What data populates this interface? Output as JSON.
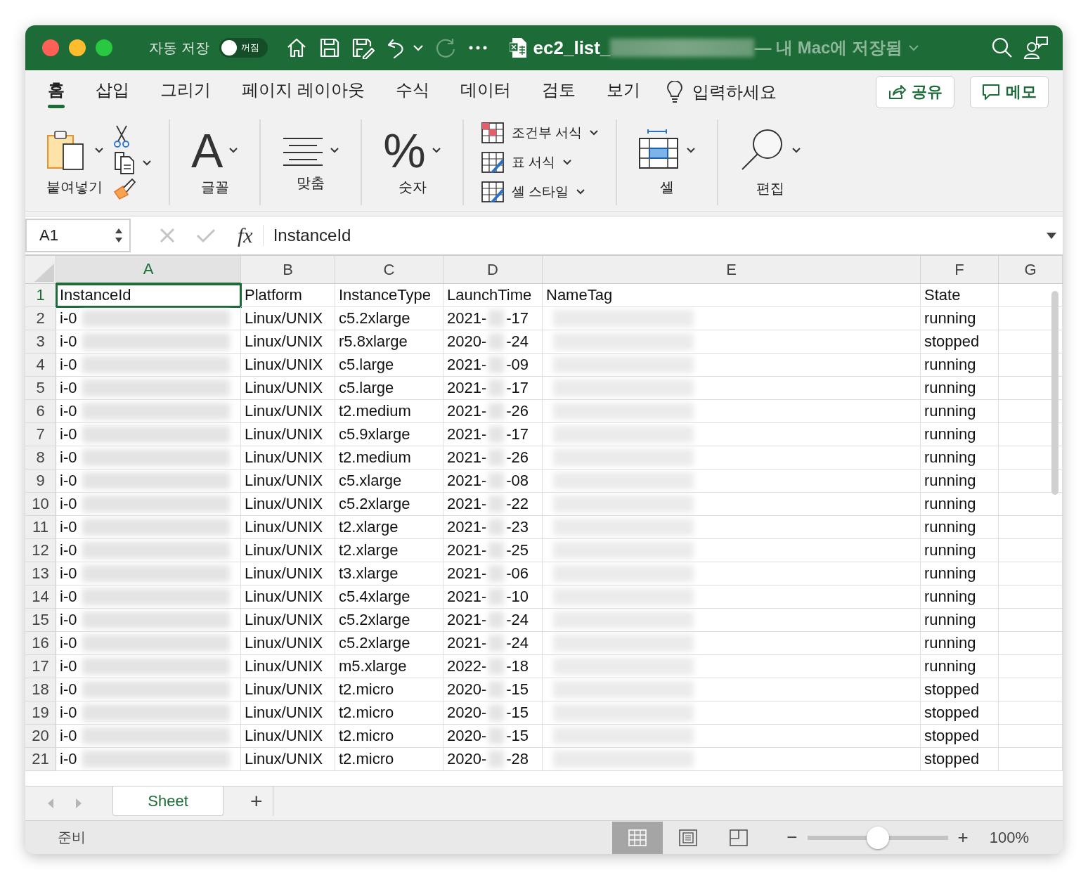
{
  "window": {
    "autosave_label": "자동 저장",
    "autosave_toggle": {
      "label": "꺼짐",
      "on": false
    },
    "file_name": "ec2_list_",
    "save_location": "— 내 Mac에 저장됨"
  },
  "ribbon_tabs": [
    {
      "label": "홈",
      "selected": true
    },
    {
      "label": "삽입",
      "selected": false
    },
    {
      "label": "그리기",
      "selected": false
    },
    {
      "label": "페이지 레이아웃",
      "selected": false
    },
    {
      "label": "수식",
      "selected": false
    },
    {
      "label": "데이터",
      "selected": false
    },
    {
      "label": "검토",
      "selected": false
    },
    {
      "label": "보기",
      "selected": false
    }
  ],
  "tell_me": "입력하세요",
  "share_button": "공유",
  "comments_button": "메모",
  "ribbon_groups": [
    {
      "kind": "paste",
      "label": "붙여넣기"
    },
    {
      "kind": "glyph",
      "glyph": "A",
      "label": "글꼴"
    },
    {
      "kind": "align",
      "label": "맞춤"
    },
    {
      "kind": "glyph",
      "glyph": "%",
      "label": "숫자"
    },
    {
      "kind": "styles",
      "items": [
        "조건부 서식",
        "표 서식",
        "셀 스타일"
      ]
    },
    {
      "kind": "cells",
      "label": "셀"
    },
    {
      "kind": "find",
      "label": "편집"
    }
  ],
  "formula_bar": {
    "name_box": "A1",
    "fx": "fx",
    "formula": "InstanceId"
  },
  "columns": [
    {
      "label": "A",
      "selected": true
    },
    {
      "label": "B",
      "selected": false
    },
    {
      "label": "C",
      "selected": false
    },
    {
      "label": "D",
      "selected": false
    },
    {
      "label": "E",
      "selected": false
    },
    {
      "label": "F",
      "selected": false
    },
    {
      "label": "G",
      "selected": false
    }
  ],
  "header_row": {
    "number": "1",
    "selected": true,
    "cells": [
      "InstanceId",
      "Platform",
      "InstanceType",
      "LaunchTime",
      "NameTag",
      "State"
    ]
  },
  "rows": [
    {
      "number": "2",
      "instance_id": "i-0",
      "platform": "Linux/UNIX",
      "type": "c5.2xlarge",
      "launch_start": "2021-",
      "launch_end": "-17",
      "state": "running"
    },
    {
      "number": "3",
      "instance_id": "i-0",
      "platform": "Linux/UNIX",
      "type": "r5.8xlarge",
      "launch_start": "2020-",
      "launch_end": "-24",
      "state": "stopped"
    },
    {
      "number": "4",
      "instance_id": "i-0",
      "platform": "Linux/UNIX",
      "type": "c5.large",
      "launch_start": "2021-",
      "launch_end": "-09",
      "state": "running"
    },
    {
      "number": "5",
      "instance_id": "i-0",
      "platform": "Linux/UNIX",
      "type": "c5.large",
      "launch_start": "2021-",
      "launch_end": "-17",
      "state": "running"
    },
    {
      "number": "6",
      "instance_id": "i-0",
      "platform": "Linux/UNIX",
      "type": "t2.medium",
      "launch_start": "2021-",
      "launch_end": "-26",
      "state": "running"
    },
    {
      "number": "7",
      "instance_id": "i-0",
      "platform": "Linux/UNIX",
      "type": "c5.9xlarge",
      "launch_start": "2021-",
      "launch_end": "-17",
      "state": "running"
    },
    {
      "number": "8",
      "instance_id": "i-0",
      "platform": "Linux/UNIX",
      "type": "t2.medium",
      "launch_start": "2021-",
      "launch_end": "-26",
      "state": "running"
    },
    {
      "number": "9",
      "instance_id": "i-0",
      "platform": "Linux/UNIX",
      "type": "c5.xlarge",
      "launch_start": "2021-",
      "launch_end": "-08",
      "state": "running"
    },
    {
      "number": "10",
      "instance_id": "i-0",
      "platform": "Linux/UNIX",
      "type": "c5.2xlarge",
      "launch_start": "2021-",
      "launch_end": "-22",
      "state": "running"
    },
    {
      "number": "11",
      "instance_id": "i-0",
      "platform": "Linux/UNIX",
      "type": "t2.xlarge",
      "launch_start": "2021-",
      "launch_end": "-23",
      "state": "running"
    },
    {
      "number": "12",
      "instance_id": "i-0",
      "platform": "Linux/UNIX",
      "type": "t2.xlarge",
      "launch_start": "2021-",
      "launch_end": "-25",
      "state": "running"
    },
    {
      "number": "13",
      "instance_id": "i-0",
      "platform": "Linux/UNIX",
      "type": "t3.xlarge",
      "launch_start": "2021-",
      "launch_end": "-06",
      "state": "running"
    },
    {
      "number": "14",
      "instance_id": "i-0",
      "platform": "Linux/UNIX",
      "type": "c5.4xlarge",
      "launch_start": "2021-",
      "launch_end": "-10",
      "state": "running"
    },
    {
      "number": "15",
      "instance_id": "i-0",
      "platform": "Linux/UNIX",
      "type": "c5.2xlarge",
      "launch_start": "2021-",
      "launch_end": "-24",
      "state": "running"
    },
    {
      "number": "16",
      "instance_id": "i-0",
      "platform": "Linux/UNIX",
      "type": "c5.2xlarge",
      "launch_start": "2021-",
      "launch_end": "-24",
      "state": "running"
    },
    {
      "number": "17",
      "instance_id": "i-0",
      "platform": "Linux/UNIX",
      "type": "m5.xlarge",
      "launch_start": "2022-",
      "launch_end": "-18",
      "state": "running"
    },
    {
      "number": "18",
      "instance_id": "i-0",
      "platform": "Linux/UNIX",
      "type": "t2.micro",
      "launch_start": "2020-",
      "launch_end": "-15",
      "state": "stopped"
    },
    {
      "number": "19",
      "instance_id": "i-0",
      "platform": "Linux/UNIX",
      "type": "t2.micro",
      "launch_start": "2020-",
      "launch_end": "-15",
      "state": "stopped"
    },
    {
      "number": "20",
      "instance_id": "i-0",
      "platform": "Linux/UNIX",
      "type": "t2.micro",
      "launch_start": "2020-",
      "launch_end": "-15",
      "state": "stopped"
    },
    {
      "number": "21",
      "instance_id": "i-0",
      "platform": "Linux/UNIX",
      "type": "t2.micro",
      "launch_start": "2020-",
      "launch_end": "-28",
      "state": "stopped"
    }
  ],
  "sheet_tabs": [
    {
      "label": "Sheet",
      "selected": true
    }
  ],
  "add_sheet": "+",
  "status_bar": {
    "status": "준비",
    "views": [
      {
        "kind": "normal",
        "selected": true
      },
      {
        "kind": "page_layout",
        "selected": false
      },
      {
        "kind": "page_break",
        "selected": false
      }
    ],
    "zoom_out": "−",
    "zoom_in": "+",
    "zoom": {
      "level": 0.5
    },
    "zoom_label": "100%"
  }
}
